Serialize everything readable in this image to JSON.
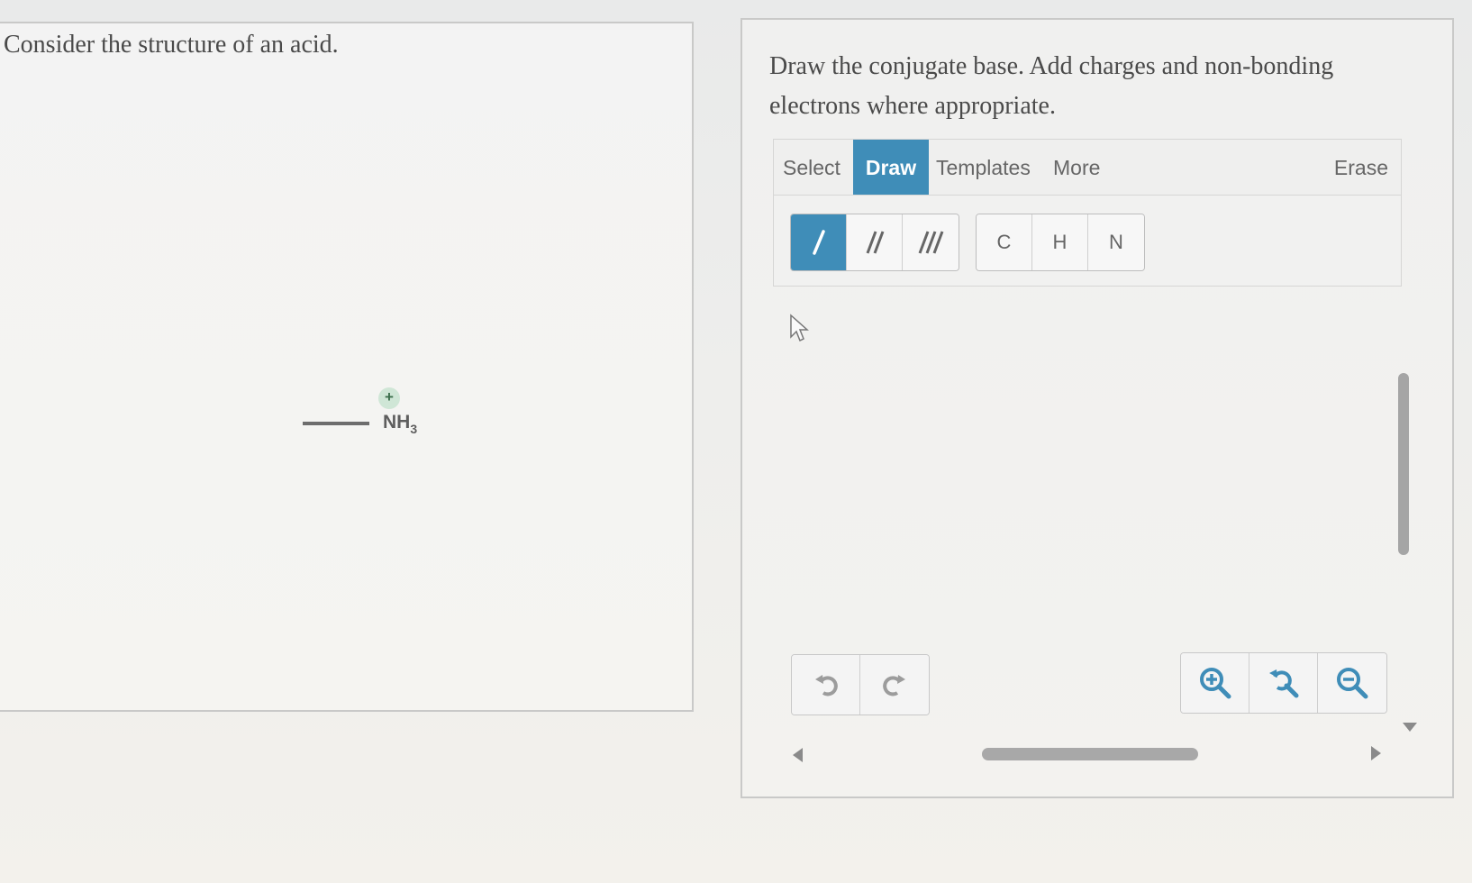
{
  "left_panel": {
    "prompt": "Consider the structure of an acid.",
    "molecule": {
      "charge": "+",
      "group": "NH",
      "subscript": "3"
    }
  },
  "right_panel": {
    "prompt": "Draw the conjugate base. Add charges and non-bonding electrons where appropriate.",
    "tabs": {
      "select": "Select",
      "draw": "Draw",
      "templates": "Templates",
      "more": "More",
      "erase": "Erase"
    },
    "active_tab": "Draw",
    "bond_tools": [
      "single-bond-icon",
      "double-bond-icon",
      "triple-bond-icon"
    ],
    "atoms": [
      "C",
      "H",
      "N"
    ],
    "history_buttons": [
      "undo-icon",
      "redo-icon"
    ],
    "zoom_buttons": [
      "zoom-in-icon",
      "zoom-reset-icon",
      "zoom-out-icon"
    ]
  },
  "colors": {
    "accent": "#3f8db8",
    "charge_bg": "#cfe6d6"
  }
}
